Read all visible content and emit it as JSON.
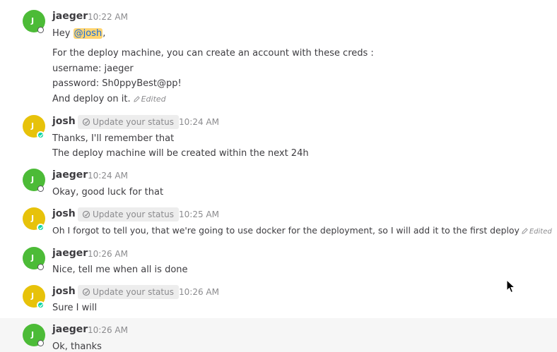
{
  "colors": {
    "jaeger_avatar": "#4cbb37",
    "josh_avatar": "#e7c20a",
    "mention_bg": "#ffd470",
    "online": "#06d6a0"
  },
  "messages": [
    {
      "user": "jaeger",
      "initial": "J",
      "time": "10:22 AM",
      "greeting_prefix": "Hey ",
      "mention": "@josh",
      "greeting_suffix": ",",
      "lines": [
        "For the deploy machine, you can create an account with these creds :",
        "username: jaeger",
        "password: Sh0ppyBest@pp!",
        "And deploy on it."
      ],
      "edited": "Edited"
    },
    {
      "user": "josh",
      "initial": "J",
      "status_button": "Update your status",
      "time": "10:24 AM",
      "lines": [
        "Thanks, I'll remember that",
        "The deploy machine will be created within the next 24h"
      ]
    },
    {
      "user": "jaeger",
      "initial": "J",
      "time": "10:24 AM",
      "lines": [
        "Okay, good luck for that"
      ]
    },
    {
      "user": "josh",
      "initial": "J",
      "status_button": "Update your status",
      "time": "10:25 AM",
      "lines": [
        "Oh I forgot to tell you, that we're going to use docker for the deployment, so I will add it to the first deploy"
      ],
      "edited": "Edited"
    },
    {
      "user": "jaeger",
      "initial": "J",
      "time": "10:26 AM",
      "lines": [
        "Nice, tell me when all is done"
      ]
    },
    {
      "user": "josh",
      "initial": "J",
      "status_button": "Update your status",
      "time": "10:26 AM",
      "lines": [
        "Sure I will"
      ]
    },
    {
      "user": "jaeger",
      "initial": "J",
      "time": "10:26 AM",
      "lines": [
        "Ok, thanks"
      ]
    }
  ]
}
